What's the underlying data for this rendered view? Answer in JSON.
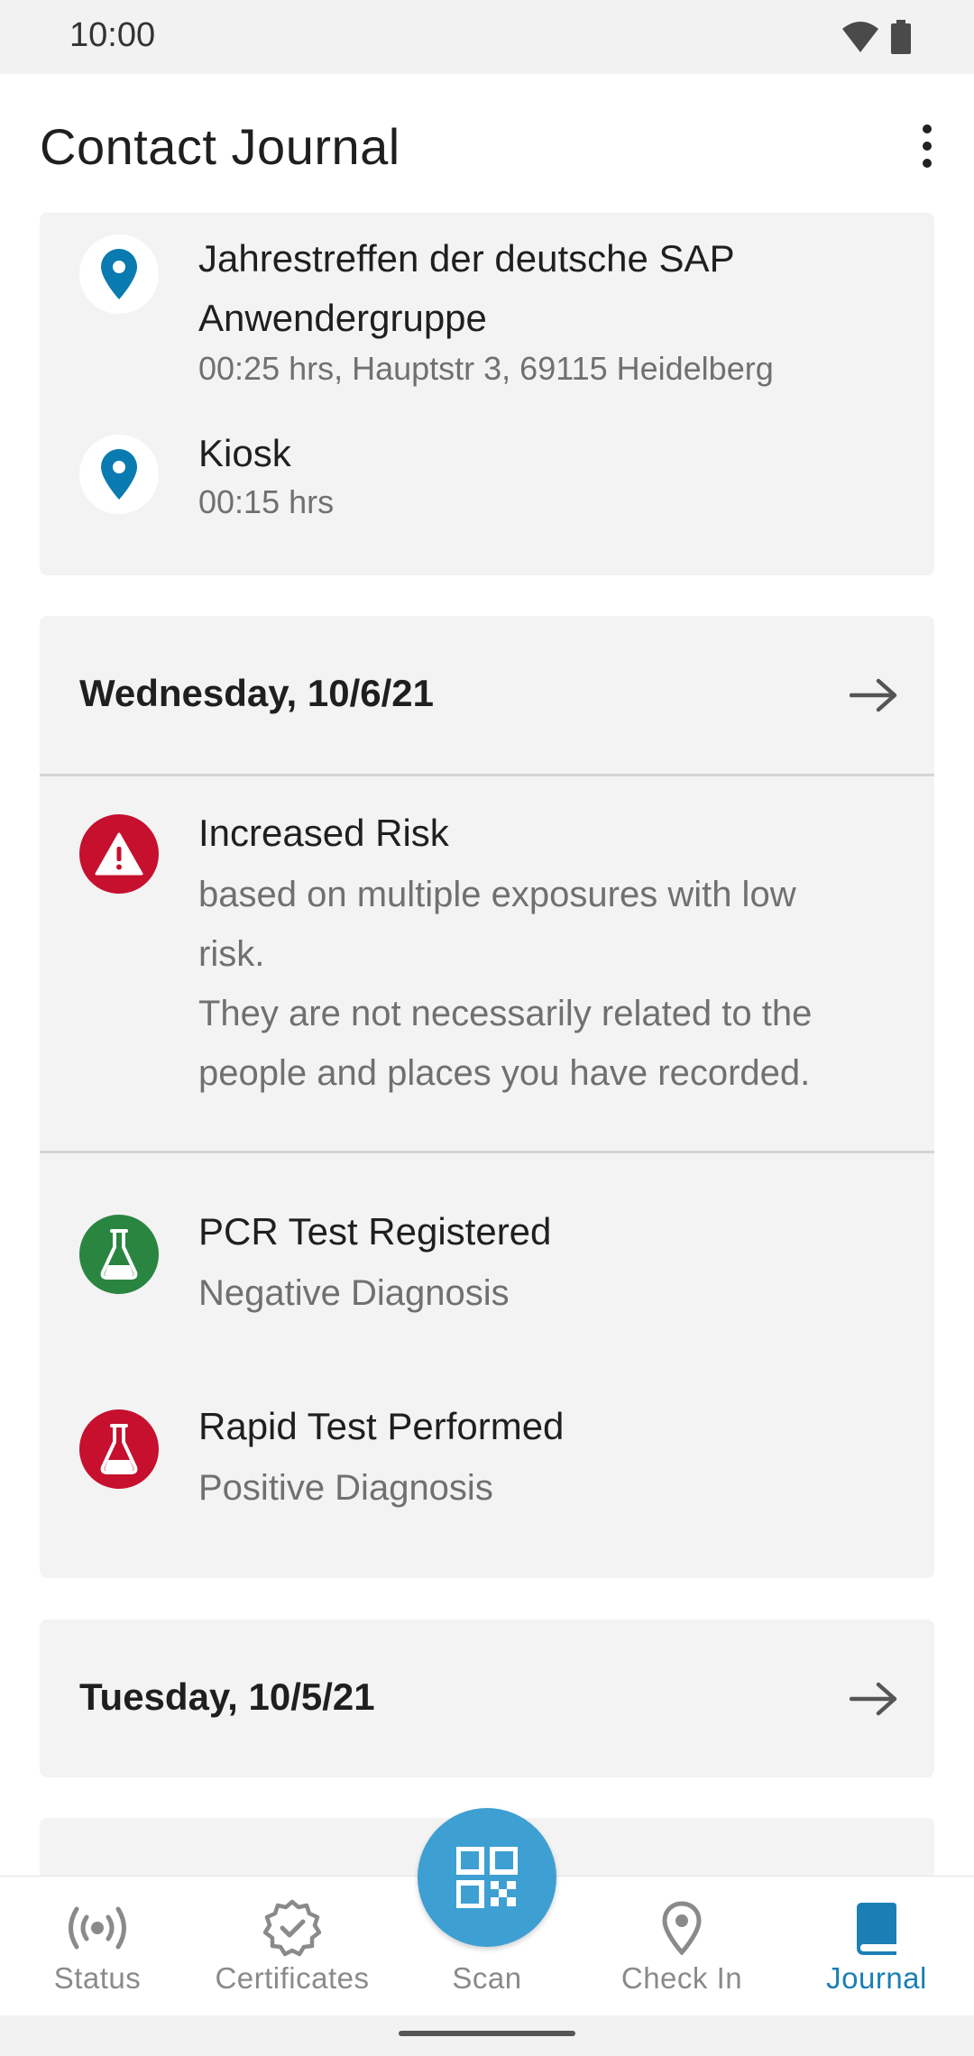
{
  "status_bar": {
    "time": "10:00"
  },
  "app_bar": {
    "title": "Contact Journal"
  },
  "entries_top": [
    {
      "title_line1": "Jahrestreffen der deutsche SAP",
      "title_line2": "Anwendergruppe",
      "detail": "00:25 hrs, Hauptstr 3, 69115 Heidelberg",
      "icon": "location-pin-icon"
    },
    {
      "title_line1": "Kiosk",
      "detail": "00:15 hrs",
      "icon": "location-pin-icon"
    }
  ],
  "day1": {
    "date": "Wednesday, 10/6/21",
    "risk": {
      "title": "Increased Risk",
      "line1": "based on multiple exposures with low",
      "line2": "risk.",
      "line3": "They are not necessarily related to the",
      "line4": "people and places you have recorded.",
      "icon": "warning-icon"
    },
    "tests": [
      {
        "title": "PCR Test Registered",
        "result": "Negative Diagnosis",
        "icon": "flask-icon",
        "color": "#2a8540"
      },
      {
        "title": "Rapid Test Performed",
        "result": "Positive Diagnosis",
        "icon": "flask-icon",
        "color": "#c6102e"
      }
    ]
  },
  "day2": {
    "date": "Tuesday, 10/5/21"
  },
  "bottom_nav": {
    "items": [
      {
        "label": "Status",
        "icon": "broadcast-icon"
      },
      {
        "label": "Certificates",
        "icon": "certificate-badge-icon"
      },
      {
        "label": "Scan",
        "icon": "qr-code-icon"
      },
      {
        "label": "Check In",
        "icon": "location-pin-icon"
      },
      {
        "label": "Journal",
        "icon": "book-icon"
      }
    ],
    "active": "Journal"
  },
  "colors": {
    "accent": "#1b7fb5",
    "fab": "#3e9fd2",
    "risk_red": "#c6102e",
    "negative_green": "#2a8540",
    "pin_blue": "#0a7bb0"
  }
}
